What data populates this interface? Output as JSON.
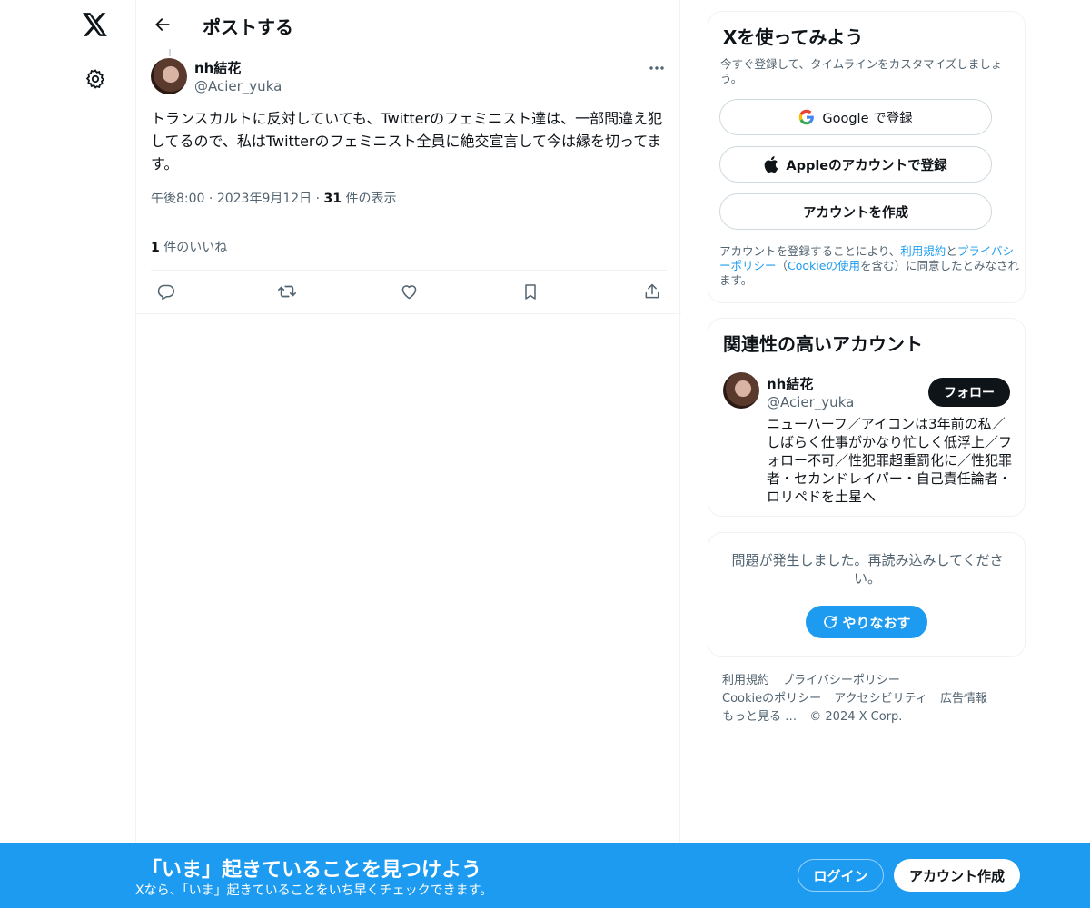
{
  "header": {
    "title": "ポストする"
  },
  "post": {
    "author_name": "nh結花",
    "author_handle": "@Acier_yuka",
    "text": "トランスカルトに反対していても、Twitterのフェミニスト達は、一部間違え犯してるので、私はTwitterのフェミニスト全員に絶交宣言して今は縁を切ってます。",
    "time": "午後8:00",
    "date": "2023年9月12日",
    "views_count": "31",
    "views_label": " 件の表示",
    "likes_count": "1",
    "likes_label": " 件のいいね"
  },
  "signup_card": {
    "title": "Xを使ってみよう",
    "subtitle": "今すぐ登録して、タイムラインをカスタマイズしましょう。",
    "google_label": "Google で登録",
    "apple_label": "Appleのアカウントで登録",
    "create_label": "アカウントを作成",
    "terms_prefix": "アカウントを登録することにより、",
    "terms_link": "利用規約",
    "terms_and": "と",
    "privacy_link": "プライバシーポリシー",
    "terms_paren_open": "（",
    "cookie_link": "Cookieの使用",
    "terms_suffix": "を含む）に同意したとみなされます。"
  },
  "relevant": {
    "title": "関連性の高いアカウント",
    "name": "nh結花",
    "handle": "@Acier_yuka",
    "follow_label": "フォロー",
    "bio": "ニューハーフ／アイコンは3年前の私／しばらく仕事がかなり忙しく低浮上／フォロー不可／性犯罪超重罰化に／性犯罪者・セカンドレイパー・自己責任論者・ロリペドを土星へ"
  },
  "error_card": {
    "message": "問題が発生しました。再読み込みしてください。",
    "retry_label": "やりなおす"
  },
  "footer": {
    "links": [
      "利用規約",
      "プライバシーポリシー",
      "Cookieのポリシー",
      "アクセシビリティ",
      "広告情報",
      "もっと見る …",
      "© 2024 X Corp."
    ]
  },
  "bottom_bar": {
    "title": "「いま」起きていることを見つけよう",
    "subtitle": "Xなら、「いま」起きていることをいち早くチェックできます。",
    "login_label": "ログイン",
    "signup_label": "アカウント作成"
  },
  "colors": {
    "accent": "#1d9bf0",
    "text": "#0f1419",
    "muted": "#536471",
    "border": "#eff3f4"
  },
  "icons": [
    "x-logo-icon",
    "gear-icon",
    "back-arrow-icon",
    "more-icon",
    "reply-icon",
    "repost-icon",
    "like-icon",
    "bookmark-icon",
    "share-icon",
    "google-icon",
    "apple-icon",
    "refresh-icon"
  ]
}
